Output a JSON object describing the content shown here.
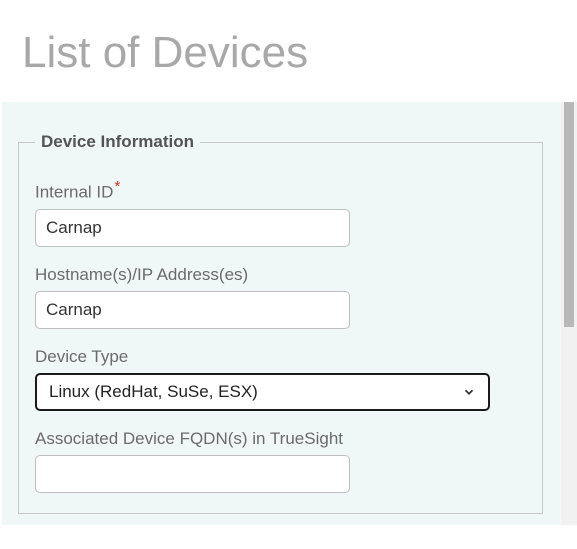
{
  "page": {
    "title": "List of Devices"
  },
  "form": {
    "legend": "Device Information",
    "fields": {
      "internal_id": {
        "label": "Internal ID",
        "required_mark": "*",
        "value": "Carnap"
      },
      "hostnames": {
        "label": "Hostname(s)/IP Address(es)",
        "value": "Carnap"
      },
      "device_type": {
        "label": "Device Type",
        "selected": "Linux (RedHat, SuSe, ESX)"
      },
      "fqdn": {
        "label": "Associated Device FQDN(s) in TrueSight",
        "value": ""
      }
    }
  }
}
